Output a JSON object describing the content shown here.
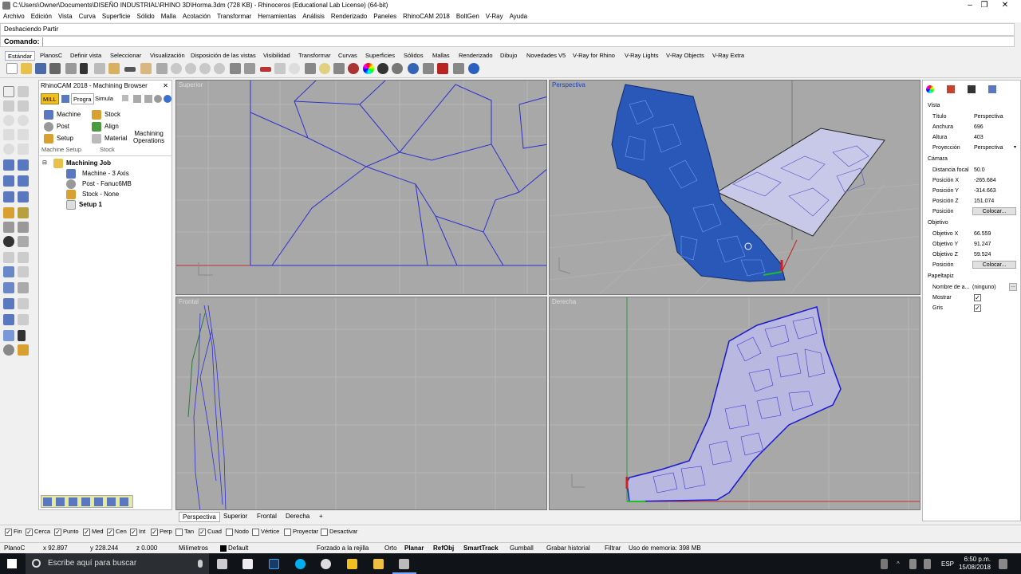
{
  "window": {
    "title": "C:\\Users\\Owner\\Documents\\DISEÑO INDUSTRIAL\\RHINO 3D\\Horma.3dm (728 KB) - Rhinoceros (Educational Lab License) (64-bit)",
    "minimize": "–",
    "maximize": "❐",
    "close": "✕"
  },
  "menu": [
    "Archivo",
    "Edición",
    "Vista",
    "Curva",
    "Superficie",
    "Sólido",
    "Malla",
    "Acotación",
    "Transformar",
    "Herramientas",
    "Análisis",
    "Renderizado",
    "Paneles",
    "RhinoCAM 2018",
    "BoltGen",
    "V-Ray",
    "Ayuda"
  ],
  "command": {
    "history": "Deshaciendo Partir",
    "label": "Comando:",
    "value": ""
  },
  "tabs": [
    "Estándar",
    "PlanosC",
    "Definir vista",
    "Seleccionar",
    "Visualización",
    "Disposición de las vistas",
    "Visibilidad",
    "Transformar",
    "Curvas",
    "Superficies",
    "Sólidos",
    "Mallas",
    "Renderizado",
    "Dibujo",
    "Novedades V5",
    "V-Ray for Rhino",
    "V-Ray Lights",
    "V-Ray Objects",
    "V-Ray Extra"
  ],
  "browser": {
    "title": "RhinoCAM 2018 - Machining Browser",
    "mode": "MILL",
    "tab_program": "Progra",
    "tab_simulate": "Simula",
    "buttons": {
      "machine": "Machine",
      "post": "Post",
      "setup": "Setup",
      "stock": "Stock",
      "align": "Align",
      "material": "Material",
      "machining_ops": "Machining\nOperations"
    },
    "groups": {
      "machine_setup": "Machine Setup",
      "stock": "Stock"
    },
    "tree": {
      "job": "Machining Job",
      "machine": "Machine - 3 Axis",
      "post": "Post - Fanuc6MB",
      "stock": "Stock - None",
      "setup": "Setup 1"
    }
  },
  "viewports": {
    "superior": "Superior",
    "perspectiva": "Perspectiva",
    "frontal": "Frontal",
    "derecha": "Derecha"
  },
  "viewport_tabs": [
    "Perspectiva",
    "Superior",
    "Frontal",
    "Derecha"
  ],
  "osnaps": [
    {
      "label": "Fin",
      "checked": true
    },
    {
      "label": "Cerca",
      "checked": true
    },
    {
      "label": "Punto",
      "checked": true
    },
    {
      "label": "Med",
      "checked": true
    },
    {
      "label": "Cen",
      "checked": true
    },
    {
      "label": "Int",
      "checked": true
    },
    {
      "label": "Perp",
      "checked": true
    },
    {
      "label": "Tan",
      "checked": false
    },
    {
      "label": "Cuad",
      "checked": true
    },
    {
      "label": "Nodo",
      "checked": false
    },
    {
      "label": "Vértice",
      "checked": false
    },
    {
      "label": "Proyectar",
      "checked": false
    },
    {
      "label": "Desactivar",
      "checked": false
    }
  ],
  "status": {
    "plane": "PlanoC",
    "x": "x 92.897",
    "y": "y 228.244",
    "z": "z 0.000",
    "units": "Milímetros",
    "layer": "Default",
    "grid_snap": "Forzado a la rejilla",
    "ortho": "Orto",
    "planar": "Planar",
    "refobj": "RefObj",
    "smarttrack": "SmartTrack",
    "gumball": "Gumball",
    "history": "Grabar historial",
    "filter": "Filtrar",
    "memory": "Uso de memoria: 398 MB"
  },
  "properties": {
    "section_view": "Vista",
    "title_label": "Título",
    "title_value": "Perspectiva",
    "width_label": "Anchura",
    "width_value": "696",
    "height_label": "Altura",
    "height_value": "403",
    "projection_label": "Proyección",
    "projection_value": "Perspectiva",
    "section_camera": "Cámara",
    "focal_label": "Distancia focal",
    "focal_value": "50.0",
    "posx_label": "Posición X",
    "posx_value": "-265.684",
    "posy_label": "Posición Y",
    "posy_value": "-314.663",
    "posz_label": "Posición Z",
    "posz_value": "151.074",
    "pos_label": "Posición",
    "place_btn": "Colocar...",
    "section_target": "Objetivo",
    "tx_label": "Objetivo X",
    "tx_value": "66.559",
    "ty_label": "Objetivo Y",
    "ty_value": "91.247",
    "tz_label": "Objetivo Z",
    "tz_value": "59.524",
    "tpos_label": "Posición",
    "tplace_btn": "Colocar...",
    "section_wallpaper": "Papeltapiz",
    "name_label": "Nombre de a...",
    "name_value": "(ninguno)",
    "show_label": "Mostrar",
    "gray_label": "Gris"
  },
  "taskbar": {
    "search": "Escribe aquí para buscar",
    "lang": "ESP",
    "time": "6:50 p.m.",
    "date": "15/08/2018"
  }
}
